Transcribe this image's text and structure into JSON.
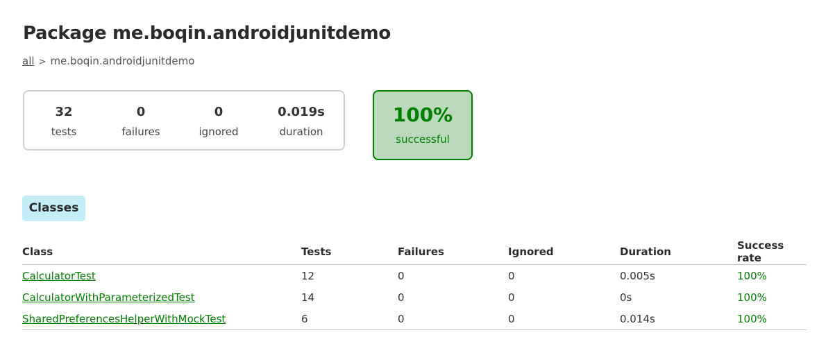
{
  "title": "Package me.boqin.androidjunitdemo",
  "breadcrumb": {
    "root": "all",
    "separator": ">",
    "current": "me.boqin.androidjunitdemo"
  },
  "summary": {
    "tests": {
      "value": "32",
      "label": "tests"
    },
    "failures": {
      "value": "0",
      "label": "failures"
    },
    "ignored": {
      "value": "0",
      "label": "ignored"
    },
    "duration": {
      "value": "0.019s",
      "label": "duration"
    }
  },
  "success": {
    "percent": "100%",
    "label": "successful"
  },
  "tab": {
    "label": "Classes"
  },
  "table": {
    "headers": [
      "Class",
      "Tests",
      "Failures",
      "Ignored",
      "Duration",
      "Success rate"
    ],
    "rows": [
      {
        "class": "CalculatorTest",
        "tests": "12",
        "failures": "0",
        "ignored": "0",
        "duration": "0.005s",
        "rate": "100%"
      },
      {
        "class": "CalculatorWithParameterizedTest",
        "tests": "14",
        "failures": "0",
        "ignored": "0",
        "duration": "0s",
        "rate": "100%"
      },
      {
        "class": "SharedPreferencesHelperWithMockTest",
        "tests": "6",
        "failures": "0",
        "ignored": "0",
        "duration": "0.014s",
        "rate": "100%"
      }
    ]
  },
  "colors": {
    "success_green": "#008000",
    "success_bg": "#bbd9bb",
    "tab_bg": "#c4eef7"
  }
}
